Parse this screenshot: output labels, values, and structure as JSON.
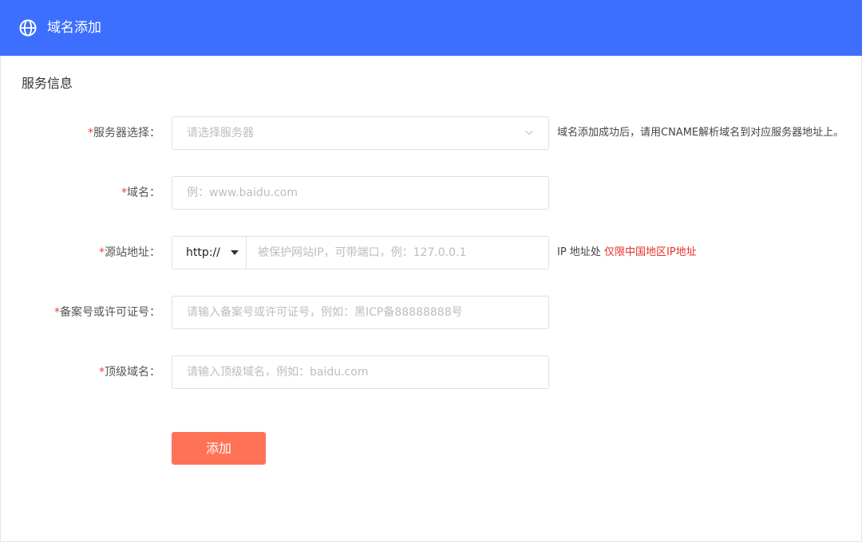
{
  "header": {
    "title": "域名添加",
    "icon": "globe-icon",
    "background": "#3d6fff"
  },
  "section": {
    "title": "服务信息"
  },
  "form": {
    "required_mark": "*",
    "server": {
      "label": "服务器选择：",
      "placeholder": "请选择服务器",
      "hint": "域名添加成功后，请用CNAME解析域名到对应服务器地址上。"
    },
    "domain": {
      "label": "域名：",
      "placeholder": "例：www.baidu.com"
    },
    "origin": {
      "label": "源站地址：",
      "protocol": "http://",
      "placeholder": "被保护网站IP，可带端口，例：127.0.0.1",
      "hint_prefix": "IP 地址处 ",
      "hint_highlight": "仅限中国地区IP地址",
      "highlight_color": "#e6312b"
    },
    "license": {
      "label": "备案号或许可证号：",
      "placeholder": "请输入备案号或许可证号，例如：黑ICP备88888888号"
    },
    "top_domain": {
      "label": "顶级域名：",
      "placeholder": "请输入顶级域名，例如：baidu.com"
    },
    "submit_label": "添加",
    "submit_color": "#ff7256"
  }
}
